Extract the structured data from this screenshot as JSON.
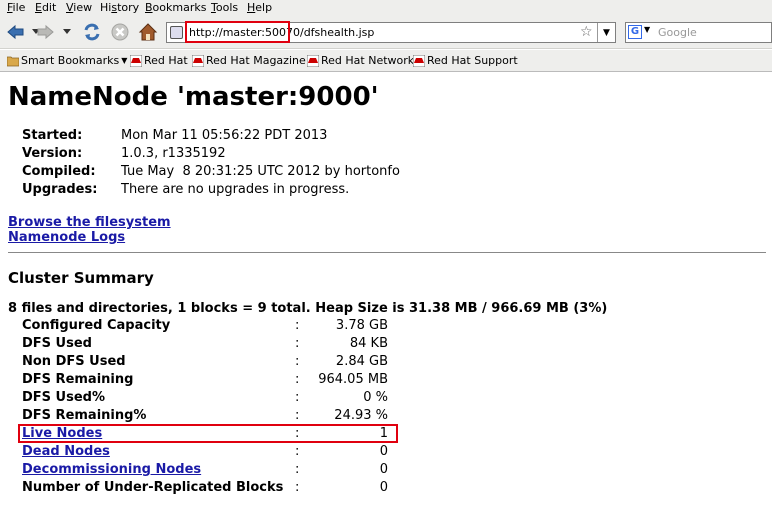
{
  "menu": [
    "File",
    "Edit",
    "View",
    "History",
    "Bookmarks",
    "Tools",
    "Help"
  ],
  "menu_access": [
    "F",
    "E",
    "V",
    "s",
    "B",
    "T",
    "H"
  ],
  "address": {
    "url": "http://master:50070/dfshealth.jsp"
  },
  "search": {
    "placeholder": "Google",
    "engine": "G"
  },
  "bookmarks": [
    "Smart Bookmarks",
    "Red Hat",
    "Red Hat Magazine",
    "Red Hat Network",
    "Red Hat Support"
  ],
  "page": {
    "title": "NameNode 'master:9000'",
    "info": [
      {
        "key": "Started:",
        "value": "Mon Mar 11 05:56:22 PDT 2013"
      },
      {
        "key": "Version:",
        "value": "1.0.3, r1335192"
      },
      {
        "key": "Compiled:",
        "value": "Tue May  8 20:31:25 UTC 2012 by hortonfo"
      },
      {
        "key": "Upgrades:",
        "value": "There are no upgrades in progress."
      }
    ],
    "links": [
      "Browse the filesystem",
      "Namenode Logs"
    ],
    "section": "Cluster Summary",
    "summary": "8 files and directories, 1 blocks = 9 total. Heap Size is 31.38 MB / 966.69 MB (3%)",
    "rows": [
      {
        "label": "Configured Capacity",
        "value": "3.78 GB",
        "link": false
      },
      {
        "label": "DFS Used",
        "value": "84 KB",
        "link": false
      },
      {
        "label": "Non DFS Used",
        "value": "2.84 GB",
        "link": false
      },
      {
        "label": "DFS Remaining",
        "value": "964.05 MB",
        "link": false
      },
      {
        "label": "DFS Used%",
        "value": "0 %",
        "link": false
      },
      {
        "label": "DFS Remaining%",
        "value": "24.93 %",
        "link": false
      },
      {
        "label": "Live Nodes",
        "value": "1",
        "link": true
      },
      {
        "label": "Dead Nodes",
        "value": "0",
        "link": true
      },
      {
        "label": "Decommissioning Nodes",
        "value": "0",
        "link": true
      },
      {
        "label": "Number of Under-Replicated Blocks",
        "value": "0",
        "link": false
      }
    ],
    "separator": ":"
  },
  "colors": {
    "link": "#1a1aa6",
    "highlight": "#e0000f",
    "chrome": "#eeeeec"
  }
}
